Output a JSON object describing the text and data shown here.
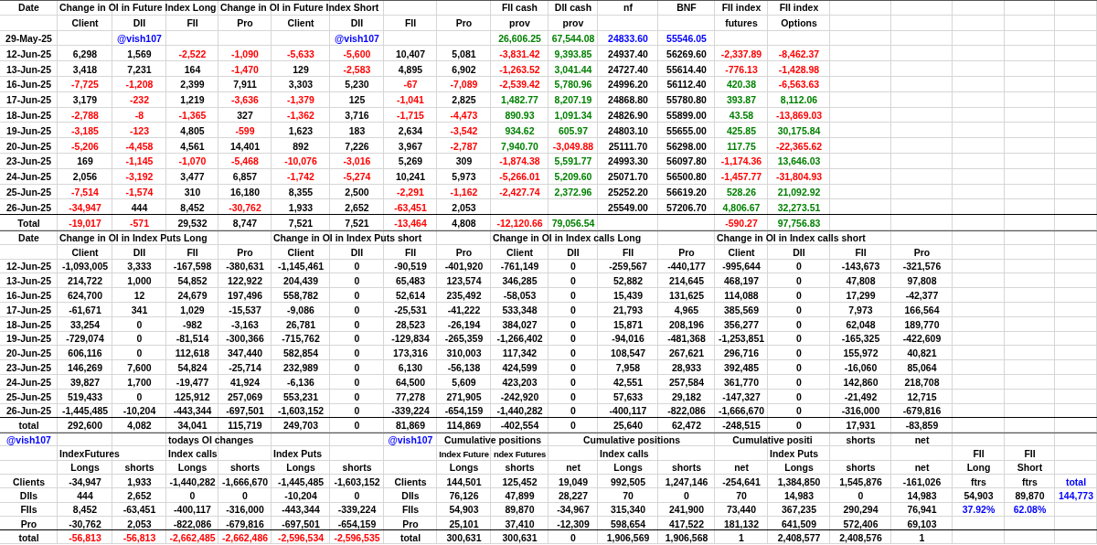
{
  "sections": [
    {
      "rows": [
        {
          "cells": [
            "Date",
            {
              "text": "Change in OI in Future Index Long",
              "kind": "heading"
            },
            null,
            null,
            {
              "text": "Change in OI in Future Index Short",
              "kind": "heading"
            },
            null,
            null,
            null,
            null,
            "FII cash",
            "DII cash",
            "nf",
            "BNF",
            "FII index",
            "FII index"
          ]
        },
        {
          "cells": [
            null,
            "Client",
            "DII",
            "FII",
            "Pro",
            "Client",
            "DII",
            "FII",
            "Pro",
            "prov",
            "prov",
            null,
            null,
            "futures",
            "Options"
          ]
        },
        {
          "cells": [
            "29-May-25",
            null,
            {
              "text": "@vish107",
              "color": "#0000ff"
            },
            null,
            null,
            null,
            {
              "text": "@vish107",
              "color": "#0000ff"
            },
            null,
            null,
            {
              "text": "26,606.25",
              "color": "#008000"
            },
            {
              "text": "67,544.08",
              "color": "#008000"
            },
            {
              "text": "24833.60",
              "color": "#0000ff"
            },
            {
              "text": "55546.05",
              "color": "#0000ff"
            }
          ]
        },
        {
          "cells": [
            "12-Jun-25",
            "6,298",
            "1,569",
            {
              "text": "-2,522",
              "color": "#ff0000"
            },
            {
              "text": "-1,090",
              "color": "#ff0000"
            },
            {
              "text": "-5,633",
              "color": "#ff0000"
            },
            {
              "text": "-5,600",
              "color": "#ff0000"
            },
            "10,407",
            "5,081",
            {
              "text": "-3,831.42",
              "color": "#ff0000"
            },
            {
              "text": "9,393.85",
              "color": "#008000"
            },
            "24937.40",
            "56269.60",
            {
              "text": "-2,337.89",
              "color": "#ff0000"
            },
            {
              "text": "-8,462.37",
              "color": "#ff0000"
            }
          ]
        },
        {
          "cells": [
            "13-Jun-25",
            "3,418",
            "7,231",
            "164",
            {
              "text": "-1,470",
              "color": "#ff0000"
            },
            "129",
            {
              "text": "-2,583",
              "color": "#ff0000"
            },
            "4,895",
            "6,902",
            {
              "text": "-1,263.52",
              "color": "#ff0000"
            },
            {
              "text": "3,041.44",
              "color": "#008000"
            },
            "24727.40",
            "55614.40",
            {
              "text": "-776.13",
              "color": "#ff0000"
            },
            {
              "text": "-1,428.98",
              "color": "#ff0000"
            }
          ]
        },
        {
          "cells": [
            "16-Jun-25",
            {
              "text": "-7,725",
              "color": "#ff0000"
            },
            {
              "text": "-1,208",
              "color": "#ff0000"
            },
            "2,399",
            "7,911",
            "3,303",
            "5,230",
            {
              "text": "-67",
              "color": "#ff0000"
            },
            {
              "text": "-7,089",
              "color": "#ff0000"
            },
            {
              "text": "-2,539.42",
              "color": "#ff0000"
            },
            {
              "text": "5,780.96",
              "color": "#008000"
            },
            "24996.20",
            "56112.40",
            {
              "text": "420.38",
              "color": "#008000"
            },
            {
              "text": "-6,563.63",
              "color": "#ff0000"
            }
          ]
        },
        {
          "cells": [
            "17-Jun-25",
            "3,179",
            {
              "text": "-232",
              "color": "#ff0000"
            },
            "1,219",
            {
              "text": "-3,636",
              "color": "#ff0000"
            },
            {
              "text": "-1,379",
              "color": "#ff0000"
            },
            "125",
            {
              "text": "-1,041",
              "color": "#ff0000"
            },
            "2,825",
            {
              "text": "1,482.77",
              "color": "#008000"
            },
            {
              "text": "8,207.19",
              "color": "#008000"
            },
            "24868.80",
            "55780.80",
            {
              "text": "393.87",
              "color": "#008000"
            },
            {
              "text": "8,112.06",
              "color": "#008000"
            }
          ]
        },
        {
          "cells": [
            "18-Jun-25",
            {
              "text": "-2,788",
              "color": "#ff0000"
            },
            {
              "text": "-8",
              "color": "#ff0000"
            },
            {
              "text": "-1,365",
              "color": "#ff0000"
            },
            "327",
            {
              "text": "-1,362",
              "color": "#ff0000"
            },
            "3,716",
            {
              "text": "-1,715",
              "color": "#ff0000"
            },
            {
              "text": "-4,473",
              "color": "#ff0000"
            },
            {
              "text": "890.93",
              "color": "#008000"
            },
            {
              "text": "1,091.34",
              "color": "#008000"
            },
            "24826.90",
            "55899.00",
            {
              "text": "43.58",
              "color": "#008000"
            },
            {
              "text": "-13,869.03",
              "color": "#ff0000"
            }
          ]
        },
        {
          "cells": [
            "19-Jun-25",
            {
              "text": "-3,185",
              "color": "#ff0000"
            },
            {
              "text": "-123",
              "color": "#ff0000"
            },
            "4,805",
            {
              "text": "-599",
              "color": "#ff0000"
            },
            "1,623",
            "183",
            "2,634",
            {
              "text": "-3,542",
              "color": "#ff0000"
            },
            {
              "text": "934.62",
              "color": "#008000"
            },
            {
              "text": "605.97",
              "color": "#008000"
            },
            "24803.10",
            "55655.00",
            {
              "text": "425.85",
              "color": "#008000"
            },
            {
              "text": "30,175.84",
              "color": "#008000"
            }
          ]
        },
        {
          "cells": [
            "20-Jun-25",
            {
              "text": "-5,206",
              "color": "#ff0000"
            },
            {
              "text": "-4,458",
              "color": "#ff0000"
            },
            "4,561",
            "14,401",
            "892",
            "7,226",
            "3,967",
            {
              "text": "-2,787",
              "color": "#ff0000"
            },
            {
              "text": "7,940.70",
              "color": "#008000"
            },
            {
              "text": "-3,049.88",
              "color": "#ff0000"
            },
            "25111.70",
            "56298.00",
            {
              "text": "117.75",
              "color": "#008000"
            },
            {
              "text": "-22,365.62",
              "color": "#ff0000"
            }
          ]
        },
        {
          "cells": [
            "23-Jun-25",
            "169",
            {
              "text": "-1,145",
              "color": "#ff0000"
            },
            {
              "text": "-1,070",
              "color": "#ff0000"
            },
            {
              "text": "-5,468",
              "color": "#ff0000"
            },
            {
              "text": "-10,076",
              "color": "#ff0000"
            },
            {
              "text": "-3,016",
              "color": "#ff0000"
            },
            "5,269",
            "309",
            {
              "text": "-1,874.38",
              "color": "#ff0000"
            },
            {
              "text": "5,591.77",
              "color": "#008000"
            },
            "24993.30",
            "56097.80",
            {
              "text": "-1,174.36",
              "color": "#ff0000"
            },
            {
              "text": "13,646.03",
              "color": "#008000"
            }
          ]
        },
        {
          "cells": [
            "24-Jun-25",
            "2,056",
            {
              "text": "-3,192",
              "color": "#ff0000"
            },
            "3,477",
            "6,857",
            {
              "text": "-1,742",
              "color": "#ff0000"
            },
            {
              "text": "-5,274",
              "color": "#ff0000"
            },
            "10,241",
            "5,973",
            {
              "text": "-5,266.01",
              "color": "#ff0000"
            },
            {
              "text": "5,209.60",
              "color": "#008000"
            },
            "25071.70",
            "56500.80",
            {
              "text": "-1,457.77",
              "color": "#ff0000"
            },
            {
              "text": "-31,804.93",
              "color": "#ff0000"
            }
          ]
        },
        {
          "cells": [
            "25-Jun-25",
            {
              "text": "-7,514",
              "color": "#ff0000"
            },
            {
              "text": "-1,574",
              "color": "#ff0000"
            },
            "310",
            "16,180",
            "8,355",
            "2,500",
            {
              "text": "-2,291",
              "color": "#ff0000"
            },
            {
              "text": "-1,162",
              "color": "#ff0000"
            },
            {
              "text": "-2,427.74",
              "color": "#ff0000"
            },
            {
              "text": "2,372.96",
              "color": "#008000"
            },
            "25252.20",
            "56619.20",
            {
              "text": "528.26",
              "color": "#008000"
            },
            {
              "text": "21,092.92",
              "color": "#008000"
            }
          ]
        },
        {
          "cells": [
            "26-Jun-25",
            {
              "text": "-34,947",
              "color": "#ff0000"
            },
            "444",
            "8,452",
            {
              "text": "-30,762",
              "color": "#ff0000"
            },
            "1,933",
            "2,652",
            {
              "text": "-63,451",
              "color": "#ff0000"
            },
            "2,053",
            null,
            null,
            "25549.00",
            "57206.70",
            {
              "text": "4,806.67",
              "color": "#008000"
            },
            {
              "text": "32,273.51",
              "color": "#008000"
            }
          ]
        },
        {
          "cells": [
            "Total",
            {
              "text": "-19,017",
              "color": "#ff0000"
            },
            {
              "text": "-571",
              "color": "#ff0000"
            },
            "29,532",
            "8,747",
            "7,521",
            "7,521",
            {
              "text": "-13,464",
              "color": "#ff0000"
            },
            "4,808",
            {
              "text": "-12,120.66",
              "color": "#ff0000"
            },
            {
              "text": "79,056.54",
              "color": "#008000"
            },
            null,
            null,
            {
              "text": "-590.27",
              "color": "#ff0000"
            },
            {
              "text": "97,756.83",
              "color": "#008000"
            }
          ]
        }
      ]
    },
    {
      "rows": [
        {
          "cells": [
            "Date",
            {
              "text": "Change in OI in Index Puts Long",
              "kind": "heading"
            },
            null,
            null,
            null,
            {
              "text": "Change in OI in Index Puts short",
              "kind": "heading"
            },
            null,
            null,
            null,
            {
              "text": "Change in OI in Index calls Long",
              "kind": "heading"
            },
            null,
            null,
            null,
            {
              "text": "Change in OI in Index calls short",
              "kind": "heading"
            },
            null,
            null,
            null
          ]
        },
        {
          "cells": [
            null,
            "Client",
            "DII",
            "FII",
            "Pro",
            "Client",
            "DII",
            "FII",
            "Pro",
            "Client",
            "DII",
            "FII",
            "Pro",
            "Client",
            "DII",
            "FII",
            "Pro"
          ]
        },
        {
          "cells": [
            "12-Jun-25",
            "-1,093,005",
            "3,333",
            "-167,598",
            "-380,631",
            "-1,145,461",
            "0",
            "-90,519",
            "-401,920",
            "-761,149",
            "0",
            "-259,567",
            "-440,177",
            "-995,644",
            "0",
            "-143,673",
            "-321,576"
          ]
        },
        {
          "cells": [
            "13-Jun-25",
            "214,722",
            "1,000",
            "54,852",
            "122,922",
            "204,439",
            "0",
            "65,483",
            "123,574",
            "346,285",
            "0",
            "52,882",
            "214,645",
            "468,197",
            "0",
            "47,808",
            "97,808"
          ]
        },
        {
          "cells": [
            "16-Jun-25",
            "624,700",
            "12",
            "24,679",
            "197,496",
            "558,782",
            "0",
            "52,614",
            "235,492",
            "-58,053",
            "0",
            "15,439",
            "131,625",
            "114,088",
            "0",
            "17,299",
            "-42,377"
          ]
        },
        {
          "cells": [
            "17-Jun-25",
            "-61,671",
            "341",
            "1,029",
            "-15,537",
            "-9,086",
            "0",
            "-25,531",
            "-41,222",
            "533,348",
            "0",
            "21,793",
            "4,965",
            "385,569",
            "0",
            "7,973",
            "166,564"
          ]
        },
        {
          "cells": [
            "18-Jun-25",
            "33,254",
            "0",
            "-982",
            "-3,163",
            "26,781",
            "0",
            "28,523",
            "-26,194",
            "384,027",
            "0",
            "15,871",
            "208,196",
            "356,277",
            "0",
            "62,048",
            "189,770"
          ]
        },
        {
          "cells": [
            "19-Jun-25",
            "-729,074",
            "0",
            "-81,514",
            "-300,366",
            "-715,762",
            "0",
            "-129,834",
            "-265,359",
            "-1,266,402",
            "0",
            "-94,016",
            "-481,368",
            "-1,253,851",
            "0",
            "-165,325",
            "-422,609"
          ]
        },
        {
          "cells": [
            "20-Jun-25",
            "606,116",
            "0",
            "112,618",
            "347,440",
            "582,854",
            "0",
            "173,316",
            "310,003",
            "117,342",
            "0",
            "108,547",
            "267,621",
            "296,716",
            "0",
            "155,972",
            "40,821"
          ]
        },
        {
          "cells": [
            "23-Jun-25",
            "146,269",
            "7,600",
            "54,824",
            "-25,714",
            "232,989",
            "0",
            "6,130",
            "-56,138",
            "424,599",
            "0",
            "7,958",
            "28,933",
            "392,485",
            "0",
            "-16,060",
            "85,064"
          ]
        },
        {
          "cells": [
            "24-Jun-25",
            "39,827",
            "1,700",
            "-19,477",
            "41,924",
            "-6,136",
            "0",
            "64,500",
            "5,609",
            "423,203",
            "0",
            "42,551",
            "257,584",
            "361,770",
            "0",
            "142,860",
            "218,708"
          ]
        },
        {
          "cells": [
            "25-Jun-25",
            "519,433",
            "0",
            "125,912",
            "257,069",
            "553,231",
            "0",
            "77,278",
            "271,905",
            "-242,920",
            "0",
            "57,633",
            "29,182",
            "-147,327",
            "0",
            "-21,492",
            "12,715"
          ]
        },
        {
          "cells": [
            "26-Jun-25",
            "-1,445,485",
            "-10,204",
            "-443,344",
            "-697,501",
            "-1,603,152",
            "0",
            "-339,224",
            "-654,159",
            "-1,440,282",
            "0",
            "-400,117",
            "-822,086",
            "-1,666,670",
            "0",
            "-316,000",
            "-679,816"
          ]
        },
        {
          "cells": [
            "total",
            "292,600",
            "4,082",
            "34,041",
            "115,719",
            "249,703",
            "0",
            "81,869",
            "114,869",
            "-402,554",
            "0",
            "25,640",
            "62,472",
            "-248,515",
            "0",
            "17,931",
            "-83,859"
          ]
        }
      ]
    },
    {
      "rows": [
        {
          "cells": [
            {
              "text": "@vish107",
              "color": "#0000ff"
            },
            null,
            null,
            {
              "text": "todays OI changes",
              "kind": "heading"
            },
            null,
            null,
            null,
            {
              "text": "@vish107",
              "color": "#0000ff"
            },
            {
              "text": "Cumulative positions",
              "kind": "title"
            },
            null,
            {
              "text": "Cumulative positions",
              "kind": "title"
            },
            null,
            null,
            {
              "text": "Cumulative positi",
              "kind": "title"
            },
            null,
            "shorts",
            "net"
          ]
        },
        {
          "cells": [
            null,
            {
              "text": "IndexFutures",
              "kind": "heading"
            },
            null,
            {
              "text": "Index calls",
              "kind": "heading"
            },
            null,
            {
              "text": "Index Puts",
              "kind": "heading"
            },
            null,
            null,
            {
              "text": "Index Future",
              "kind": "compact"
            },
            {
              "text": "ndex Futures",
              "kind": "compact"
            },
            null,
            {
              "text": "Index calls",
              "kind": "heading"
            },
            null,
            null,
            {
              "text": "Index Puts",
              "kind": "heading"
            },
            null,
            null,
            "FII",
            "FII"
          ]
        },
        {
          "cells": [
            null,
            "Longs",
            "shorts",
            "Longs",
            "shorts",
            "Longs",
            "shorts",
            null,
            "Longs",
            "shorts",
            "net",
            "Longs",
            "shorts",
            "net",
            "Longs",
            "shorts",
            "net",
            "Long",
            "Short"
          ]
        },
        {
          "cells": [
            "Clients",
            "-34,947",
            "1,933",
            "-1,440,282",
            "-1,666,670",
            "-1,445,485",
            "-1,603,152",
            "Clients",
            "144,501",
            "125,452",
            "19,049",
            "992,505",
            "1,247,146",
            "-254,641",
            "1,384,850",
            "1,545,876",
            "-161,026",
            "ftrs",
            "ftrs",
            {
              "text": "total",
              "color": "#0000ff"
            }
          ]
        },
        {
          "cells": [
            "DIIs",
            "444",
            "2,652",
            "0",
            "0",
            "-10,204",
            "0",
            "DIIs",
            "76,126",
            "47,899",
            "28,227",
            "70",
            "0",
            "70",
            "14,983",
            "0",
            "14,983",
            "54,903",
            "89,870",
            {
              "text": "144,773",
              "color": "#0000ff"
            }
          ]
        },
        {
          "cells": [
            "FIIs",
            "8,452",
            "-63,451",
            "-400,117",
            "-316,000",
            "-443,344",
            "-339,224",
            "FIIs",
            "54,903",
            "89,870",
            "-34,967",
            "315,340",
            "241,900",
            "73,440",
            "367,235",
            "290,294",
            "76,941",
            {
              "text": "37.92%",
              "color": "#0000ff"
            },
            {
              "text": "62.08%",
              "color": "#0000ff"
            }
          ]
        },
        {
          "cells": [
            "Pro",
            "-30,762",
            "2,053",
            "-822,086",
            "-679,816",
            "-697,501",
            "-654,159",
            "Pro",
            "25,101",
            "37,410",
            "-12,309",
            "598,654",
            "417,522",
            "181,132",
            "641,509",
            "572,406",
            "69,103"
          ]
        },
        {
          "cells": [
            "total",
            {
              "text": "-56,813",
              "color": "#ff0000"
            },
            {
              "text": "-56,813",
              "color": "#ff0000"
            },
            {
              "text": "-2,662,485",
              "color": "#ff0000"
            },
            {
              "text": "-2,662,486",
              "color": "#ff0000"
            },
            {
              "text": "-2,596,534",
              "color": "#ff0000"
            },
            {
              "text": "-2,596,535",
              "color": "#ff0000"
            },
            "total",
            "300,631",
            "300,631",
            "0",
            "1,906,569",
            "1,906,568",
            "1",
            "2,408,577",
            "2,408,576",
            "1"
          ]
        }
      ]
    }
  ]
}
